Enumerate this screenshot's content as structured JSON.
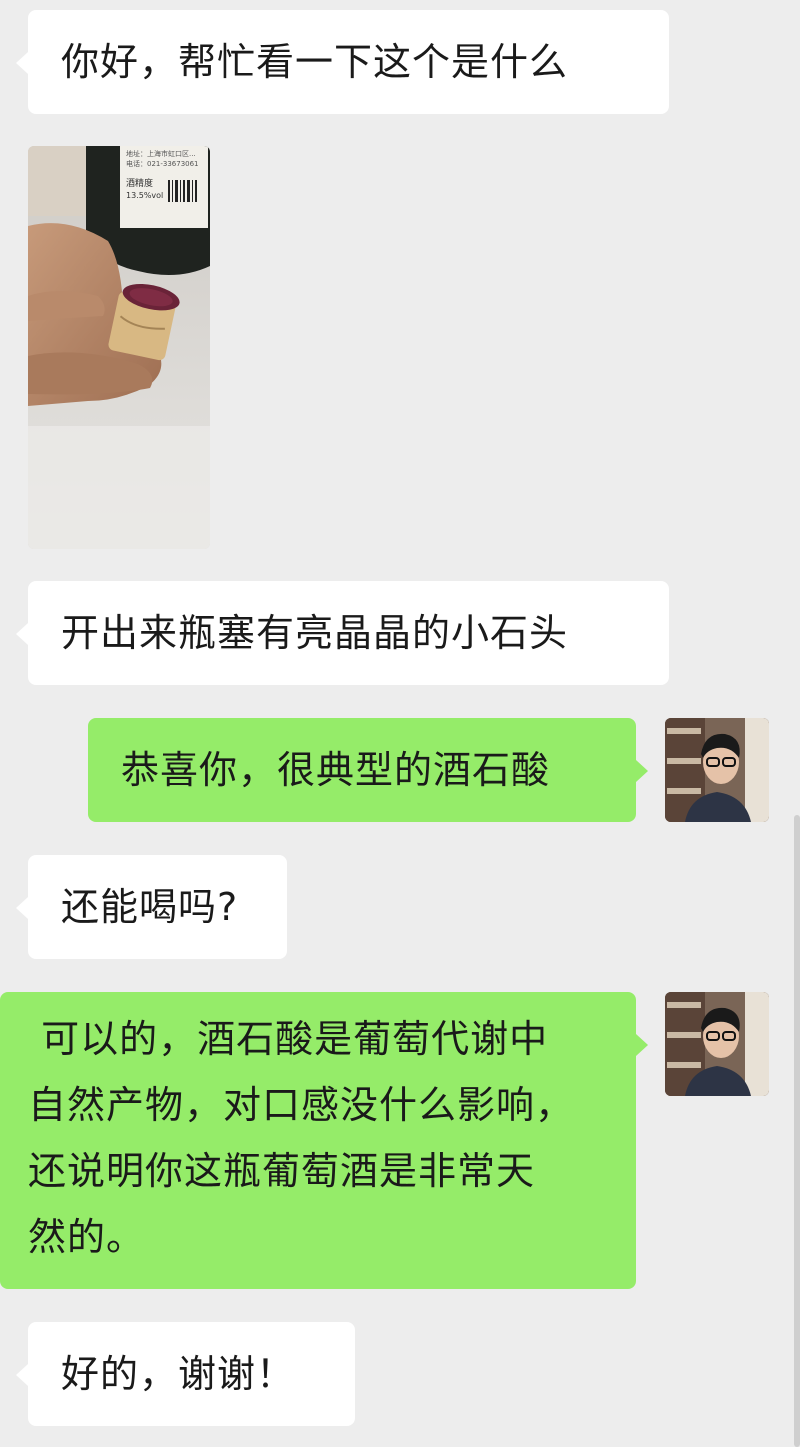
{
  "messages": [
    {
      "side": "left",
      "type": "text",
      "text": "你好，帮忙看一下这个是什么"
    },
    {
      "side": "left",
      "type": "image",
      "icon": "photo-wine-cork"
    },
    {
      "side": "left",
      "type": "text",
      "text": "开出来瓶塞有亮晶晶的小石头"
    },
    {
      "side": "right",
      "type": "text",
      "text": "恭喜你，很典型的酒石酸"
    },
    {
      "side": "left",
      "type": "text",
      "text": "还能喝吗?"
    },
    {
      "side": "right",
      "type": "text",
      "lines": [
        " 可以的，酒石酸是葡萄代谢中",
        "自然产物，对口感没什么影响，",
        "还说明你这瓶葡萄酒是非常天",
        "然的。"
      ]
    },
    {
      "side": "left",
      "type": "text",
      "text": "好的，谢谢！"
    }
  ],
  "photo": {
    "label_lines": [
      "地址：上海市虹口区...",
      "电话：021-33673061",
      "酒精度",
      "13.5%vol"
    ]
  },
  "colors": {
    "background": "#ededed",
    "left_bubble": "#ffffff",
    "right_bubble": "#95ec69"
  }
}
